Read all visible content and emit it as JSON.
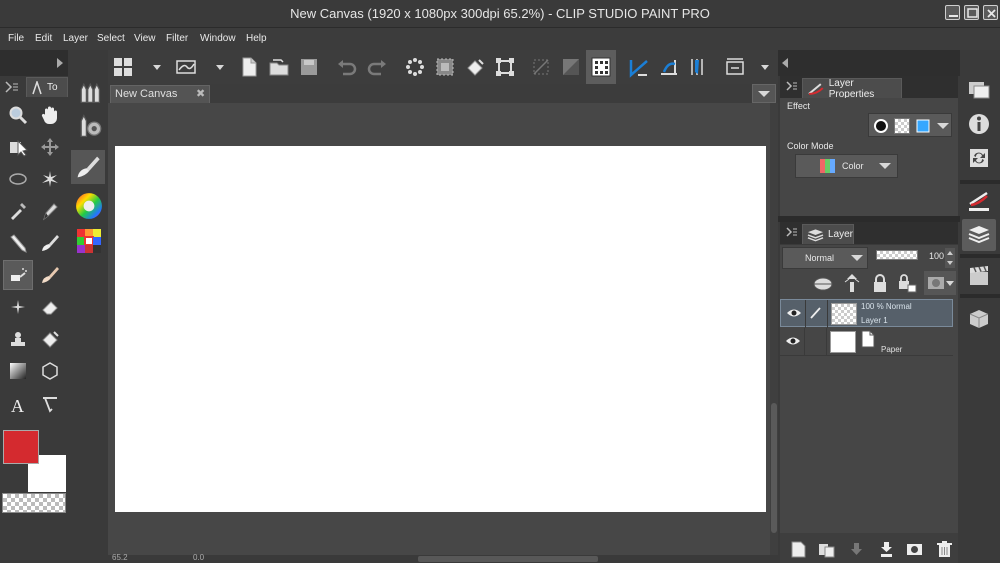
{
  "window": {
    "title": "New Canvas (1920 x 1080px 300dpi 65.2%)  - CLIP STUDIO PAINT PRO"
  },
  "menu": [
    "File",
    "Edit",
    "Layer",
    "Select",
    "View",
    "Filter",
    "Window",
    "Help"
  ],
  "tool_panel": {
    "tab_label": "To"
  },
  "colors": {
    "main": "#d42a2f",
    "sub": "#ffffff",
    "accent_blue": "#1b7fd6"
  },
  "document": {
    "tab_label": "New Canvas",
    "close_glyph": "✖",
    "zoom": "65.2",
    "angle": "0.0"
  },
  "layer_properties": {
    "tab_label": "Layer Properties",
    "effect_label": "Effect",
    "color_mode_label": "Color Mode",
    "color_mode_value": "Color"
  },
  "layer_panel": {
    "tab_label": "Layer",
    "blend_mode": "Normal",
    "opacity": "100",
    "layers": [
      {
        "info": "100 %  Normal",
        "name": "Layer 1",
        "selected": true
      },
      {
        "info": "",
        "name": "Paper",
        "selected": false
      }
    ]
  },
  "icons": {
    "tools": [
      "zoom-icon",
      "hand-icon",
      "operation-icon",
      "move-layer-icon",
      "lasso-icon",
      "auto-select-icon",
      "eyedropper-icon",
      "pen-icon",
      "pencil-icon",
      "brush-icon",
      "airbrush-icon",
      "blend-icon",
      "decoration-icon",
      "eraser-icon",
      "stamp-icon",
      "fill-icon",
      "gradient-icon",
      "figure-icon",
      "text-icon",
      "ruler-icon"
    ],
    "side": [
      "navigator-icon",
      "sub-view-icon",
      "tool-property-icon",
      "layer-icon",
      "animation-icon",
      "material-icon"
    ]
  }
}
